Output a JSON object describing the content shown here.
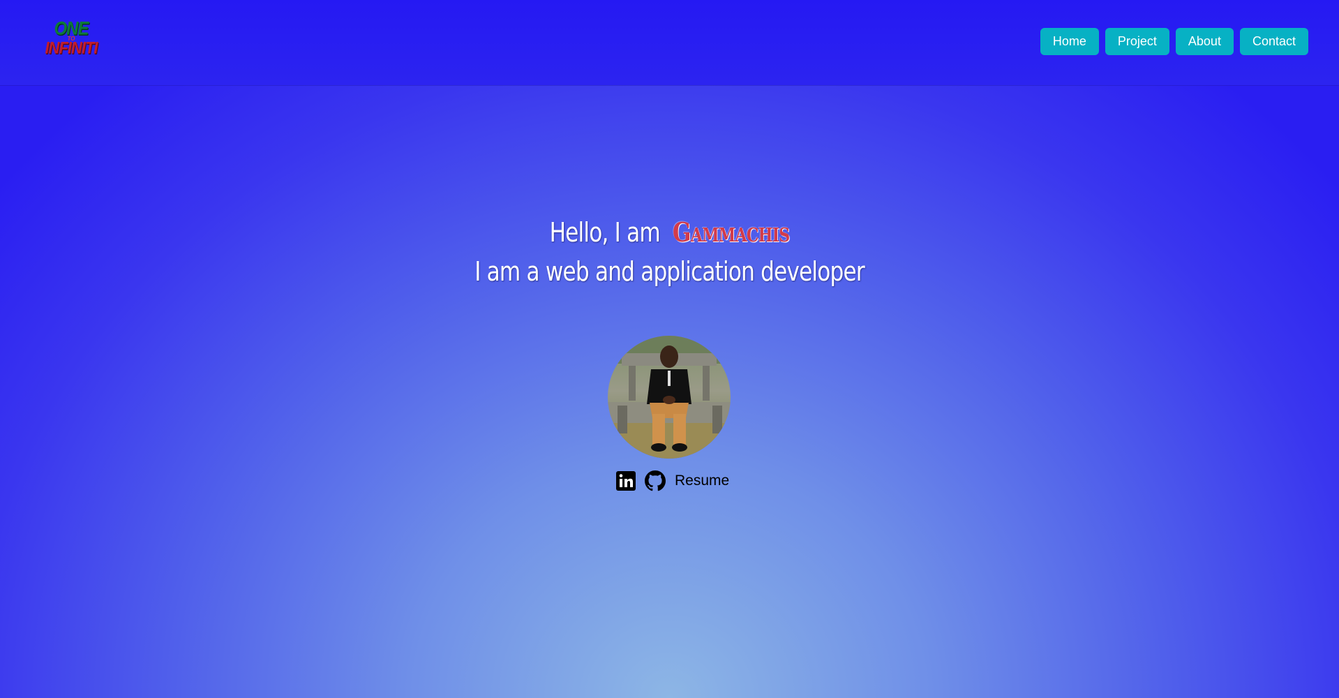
{
  "brand": {
    "logo_line1": "ONE",
    "logo_line2": "TO",
    "logo_line3": "INFINITI"
  },
  "nav": {
    "items": [
      {
        "label": "Home"
      },
      {
        "label": "Project"
      },
      {
        "label": "About"
      },
      {
        "label": "Contact"
      }
    ]
  },
  "hero": {
    "greeting": "Hello, I am",
    "name": "Gammachis",
    "tagline": "I am a web and application developer"
  },
  "profile": {
    "photo": "profile-photo"
  },
  "social": {
    "linkedin_icon": "linkedin-icon",
    "github_icon": "github-icon",
    "resume_label": "Resume"
  },
  "colors": {
    "nav_button": "#07b1c4",
    "background_top": "#2519f3",
    "background_bottom": "#8db6e5",
    "name_accent": "#d23b4a"
  }
}
